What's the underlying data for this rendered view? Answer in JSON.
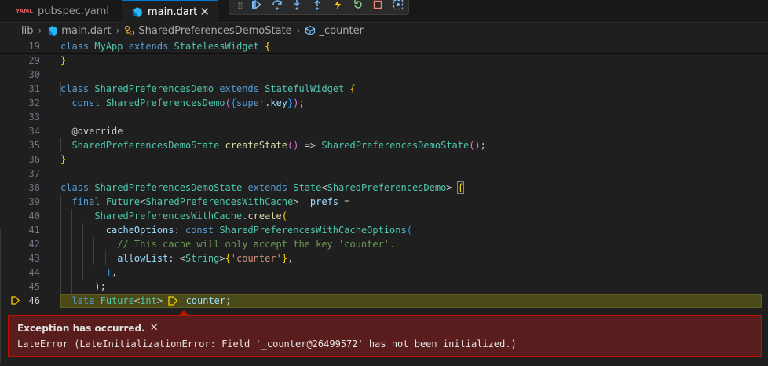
{
  "tabs": [
    {
      "label": "pubspec.yaml",
      "badge": "YAML",
      "active": false
    },
    {
      "label": "main.dart",
      "close": "✕",
      "active": true
    }
  ],
  "breadcrumb": [
    "lib",
    "main.dart",
    "SharedPreferencesDemoState",
    "_counter"
  ],
  "sticky_line": {
    "number": "19"
  },
  "line_numbers": [
    "29",
    "30",
    "31",
    "32",
    "33",
    "34",
    "35",
    "36",
    "37",
    "38",
    "39",
    "40",
    "41",
    "42",
    "43",
    "44",
    "45",
    "46"
  ],
  "exception": {
    "title": "Exception has occurred.",
    "close": "✕",
    "message": "LateError (LateInitializationError: Field '_counter@26499572' has not been initialized.)"
  },
  "colors": {
    "accent": "#0078d4",
    "exception_bg": "#5a1d1d",
    "exception_border": "#be1100",
    "current_line": "#4b4a19"
  }
}
